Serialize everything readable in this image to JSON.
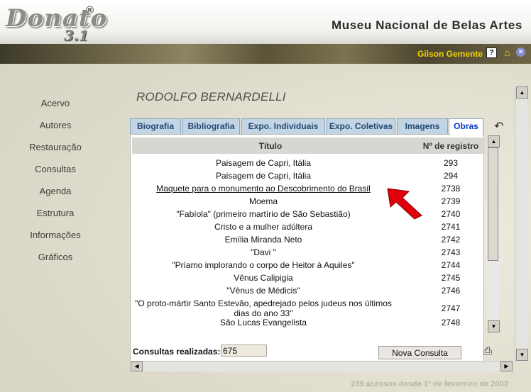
{
  "app": {
    "logo": "Donato",
    "logo_mark": "®",
    "version": "3.1",
    "museum": "Museu Nacional de Belas Artes"
  },
  "user": {
    "name": "Gilson Gemente"
  },
  "sidebar": {
    "items": [
      "Acervo",
      "Autores",
      "Restauração",
      "Consultas",
      "Agenda",
      "Estrutura",
      "Informações",
      "Gráficos"
    ]
  },
  "artist": "RODOLFO BERNARDELLI",
  "tabs": [
    {
      "label": "Biografia",
      "active": false
    },
    {
      "label": "Bibliografia",
      "active": false
    },
    {
      "label": "Expo. Individuais",
      "active": false
    },
    {
      "label": "Expo. Coletivas",
      "active": false
    },
    {
      "label": "Imagens",
      "active": false
    },
    {
      "label": "Obras",
      "active": true
    }
  ],
  "table": {
    "headers": {
      "title": "Título",
      "reg": "Nº de registro"
    },
    "rows": [
      {
        "title": "Paisagem de Capri, Itália",
        "reg": "293",
        "link": false
      },
      {
        "title": "Paisagem de Capri, Itália",
        "reg": "294",
        "link": false
      },
      {
        "title": "Maquete para o monumento ao Descobrimento do Brasil",
        "reg": "2738",
        "link": true
      },
      {
        "title": "Moema",
        "reg": "2739",
        "link": false
      },
      {
        "title": "\"Fabíola\" (primeiro martírio de São Sebastião)",
        "reg": "2740",
        "link": false
      },
      {
        "title": "Cristo e a mulher adúltera",
        "reg": "2741",
        "link": false
      },
      {
        "title": "Emília Miranda Neto",
        "reg": "2742",
        "link": false
      },
      {
        "title": "\"Davi \"",
        "reg": "2743",
        "link": false
      },
      {
        "title": "\"Príamo implorando o corpo de Heitor à Aquiles\"",
        "reg": "2744",
        "link": false
      },
      {
        "title": "Vênus Calipigia",
        "reg": "2745",
        "link": false
      },
      {
        "title": "\"Vênus de Médicis\"",
        "reg": "2746",
        "link": false
      },
      {
        "title": "\"O proto-mártir Santo Estevão, apedrejado pelos judeus nos últimos dias do ano 33\"",
        "reg": "2747",
        "link": false
      },
      {
        "title": "São Lucas Evangelista",
        "reg": "2748",
        "link": false
      }
    ]
  },
  "footer": {
    "label": "Consultas realizadas:",
    "count": "675",
    "new_button": "Nova Consulta"
  },
  "access_line": "239 acessos desde 1º de fevereiro de 2003",
  "colors": {
    "accent_user": "#f1d400",
    "tab_active_text": "#003ac7",
    "arrow": "#e0000b"
  }
}
